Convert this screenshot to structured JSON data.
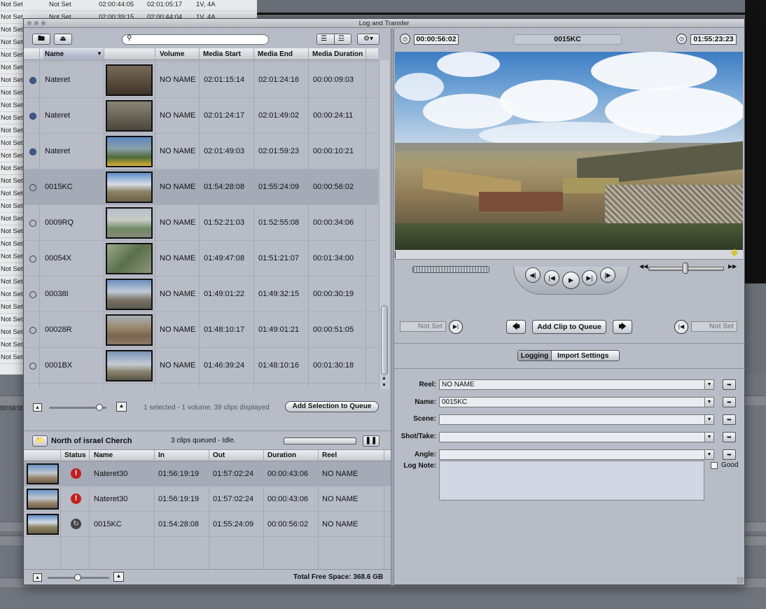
{
  "background": {
    "rows": [
      {
        "col1": "Not Set",
        "col2": "Not Set",
        "col3": "02:00:44:05",
        "col4": "02:01:05:17",
        "col5": "1V, 4A"
      },
      {
        "col1": "Not Set",
        "col2": "Not Set",
        "col3": "02:00:39:15",
        "col4": "02:00:44:04",
        "col5": "1V, 4A"
      },
      {
        "col1": "Not Set"
      },
      {
        "col1": "Not Set"
      },
      {
        "col1": "Not Set"
      },
      {
        "col1": "Not Set"
      },
      {
        "col1": "Not Set"
      },
      {
        "col1": "Not Set"
      },
      {
        "col1": "Not Set"
      },
      {
        "col1": "Not Set"
      },
      {
        "col1": "Not Set"
      },
      {
        "col1": "Not Set"
      },
      {
        "col1": "Not Set"
      },
      {
        "col1": "Not Set"
      },
      {
        "col1": "Not Set"
      },
      {
        "col1": "Not Set"
      },
      {
        "col1": "Not Set"
      },
      {
        "col1": "Not Set"
      },
      {
        "col1": "Not Set"
      },
      {
        "col1": "Not Set"
      },
      {
        "col1": "Not Set"
      },
      {
        "col1": "Not Set"
      },
      {
        "col1": "Not Set"
      },
      {
        "col1": "Not Set"
      },
      {
        "col1": "Not Set"
      },
      {
        "col1": "Not Set"
      },
      {
        "col1": "Not Set"
      },
      {
        "col1": "Not Set"
      },
      {
        "col1": "Not Set"
      }
    ],
    "timeline_timecode": "00:04:00"
  },
  "window": {
    "title": "Log and Transfer"
  },
  "browser": {
    "search_placeholder": "",
    "columns": {
      "name": "Name",
      "volume": "Volume",
      "media_start": "Media Start",
      "media_end": "Media End",
      "media_duration": "Media Duration"
    },
    "rows": [
      {
        "status": "filled",
        "name": "Nateret",
        "volume": "NO NAME",
        "start": "02:01:15:14",
        "end": "02:01:24:16",
        "duration": "00:00:09:03",
        "thumb_color": "#5a4a3a"
      },
      {
        "status": "filled",
        "name": "Nateret",
        "volume": "NO NAME",
        "start": "02:01:24:17",
        "end": "02:01:49:02",
        "duration": "00:00:24:11",
        "thumb_color": "#6e6a5e"
      },
      {
        "status": "filled",
        "name": "Nateret",
        "volume": "NO NAME",
        "start": "02:01:49:03",
        "end": "02:01:59:23",
        "duration": "00:00:10:21",
        "thumb_color": "#4f6a3a"
      },
      {
        "status": "empty",
        "name": "0015KC",
        "volume": "NO NAME",
        "start": "01:54:28:08",
        "end": "01:55:24:09",
        "duration": "00:00:56:02",
        "thumb_color": "#8fa6b8"
      },
      {
        "status": "empty",
        "name": "0009RQ",
        "volume": "NO NAME",
        "start": "01:52:21:03",
        "end": "01:52:55:08",
        "duration": "00:00:34:06",
        "thumb_color": "#8a9a8a"
      },
      {
        "status": "empty",
        "name": "00054X",
        "volume": "NO NAME",
        "start": "01:49:47:08",
        "end": "01:51:21:07",
        "duration": "00:01:34:00",
        "thumb_color": "#6d7a5c"
      },
      {
        "status": "empty",
        "name": "00038I",
        "volume": "NO NAME",
        "start": "01:49:01:22",
        "end": "01:49:32:15",
        "duration": "00:00:30:19",
        "thumb_color": "#7f8fa0"
      },
      {
        "status": "empty",
        "name": "00028R",
        "volume": "NO NAME",
        "start": "01:48:10:17",
        "end": "01:49:01:21",
        "duration": "00:00:51:05",
        "thumb_color": "#8a7a60"
      },
      {
        "status": "empty",
        "name": "0001BX",
        "volume": "NO NAME",
        "start": "01:46:39:24",
        "end": "01:48:10:16",
        "duration": "00:01:30:18",
        "thumb_color": "#8c96a6"
      }
    ],
    "status_text": "1 selected - 1 volume, 39 clips displayed",
    "add_selection_label": "Add Selection to Queue"
  },
  "queue": {
    "project_name": "North of israel Cherch",
    "status_text": "3 clips queued - Idle.",
    "pause_icon": "pause-icon",
    "columns": {
      "status": "Status",
      "name": "Name",
      "in": "In",
      "out": "Out",
      "duration": "Duration",
      "reel": "Reel"
    },
    "rows": [
      {
        "status": "error",
        "name": "Nateret30",
        "in": "01:56:19:19",
        "out": "01:57:02:24",
        "duration": "00:00:43:06",
        "reel": "NO NAME"
      },
      {
        "status": "error",
        "name": "Nateret30",
        "in": "01:56:19:19",
        "out": "01:57:02:24",
        "duration": "00:00:43:06",
        "reel": "NO NAME"
      },
      {
        "status": "processing",
        "name": "0015KC",
        "in": "01:54:28:08",
        "out": "01:55:24:09",
        "duration": "00:00:56:02",
        "reel": "NO NAME"
      }
    ],
    "free_space": "Total Free Space: 368.6 GB"
  },
  "viewer": {
    "duration_tc": "00:00:56:02",
    "clip_name": "0015KC",
    "current_tc": "01:55:23:23",
    "mark_in": "Not Set",
    "mark_out": "Not Set",
    "add_clip_label": "Add Clip to Queue"
  },
  "logging": {
    "tabs": [
      "Logging",
      "Import Settings"
    ],
    "active_tab": "Logging",
    "fields": [
      {
        "label": "Reel:",
        "value": "NO NAME"
      },
      {
        "label": "Name:",
        "value": "0015KC"
      },
      {
        "label": "Scene:",
        "value": ""
      },
      {
        "label": "Shot/Take:",
        "value": ""
      },
      {
        "label": "Angle:",
        "value": ""
      }
    ],
    "log_note_label": "Log Note:",
    "log_note_value": "",
    "good_label": "Good",
    "good_checked": false
  }
}
